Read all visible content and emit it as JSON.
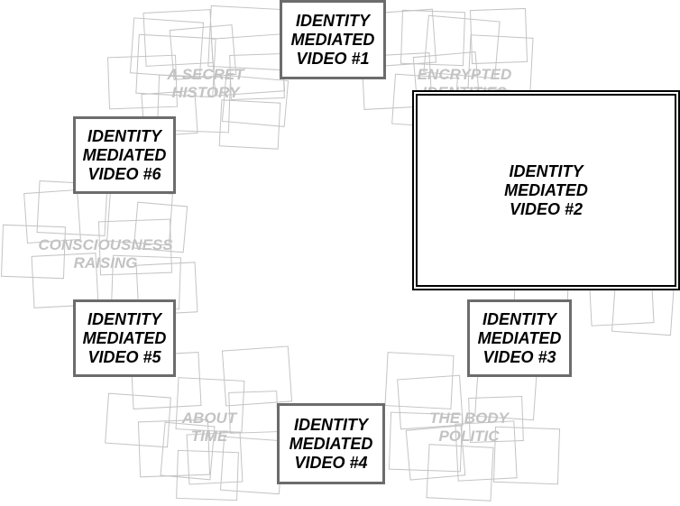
{
  "clusters": [
    {
      "id": "secret-history",
      "label": "A SECRET\nHISTORY"
    },
    {
      "id": "encrypted-identities",
      "label": "ENCRYPTED\nIDENTITIES"
    },
    {
      "id": "consciousness-raising",
      "label": "CONSCIOUSNESS\nRAISING"
    },
    {
      "id": "about-time",
      "label": "ABOUT\nTIME"
    },
    {
      "id": "body-politic",
      "label": "THE BODY\nPOLITIC"
    }
  ],
  "videos": [
    {
      "id": "video-1",
      "label": "IDENTITY\nMEDIATED\nVIDEO #1"
    },
    {
      "id": "video-2",
      "label": "IDENTITY\nMEDIATED\nVIDEO #2",
      "featured": true
    },
    {
      "id": "video-3",
      "label": "IDENTITY\nMEDIATED\nVIDEO #3"
    },
    {
      "id": "video-4",
      "label": "IDENTITY\nMEDIATED\nVIDEO #4"
    },
    {
      "id": "video-5",
      "label": "IDENTITY\nMEDIATED\nVIDEO #5"
    },
    {
      "id": "video-6",
      "label": "IDENTITY\nMEDIATED\nVIDEO #6"
    }
  ],
  "colors": {
    "frame": "#c4c4c4",
    "box_border": "#6c6c6c",
    "featured_border": "#000000",
    "ghost_text": "#c3c3c3"
  }
}
